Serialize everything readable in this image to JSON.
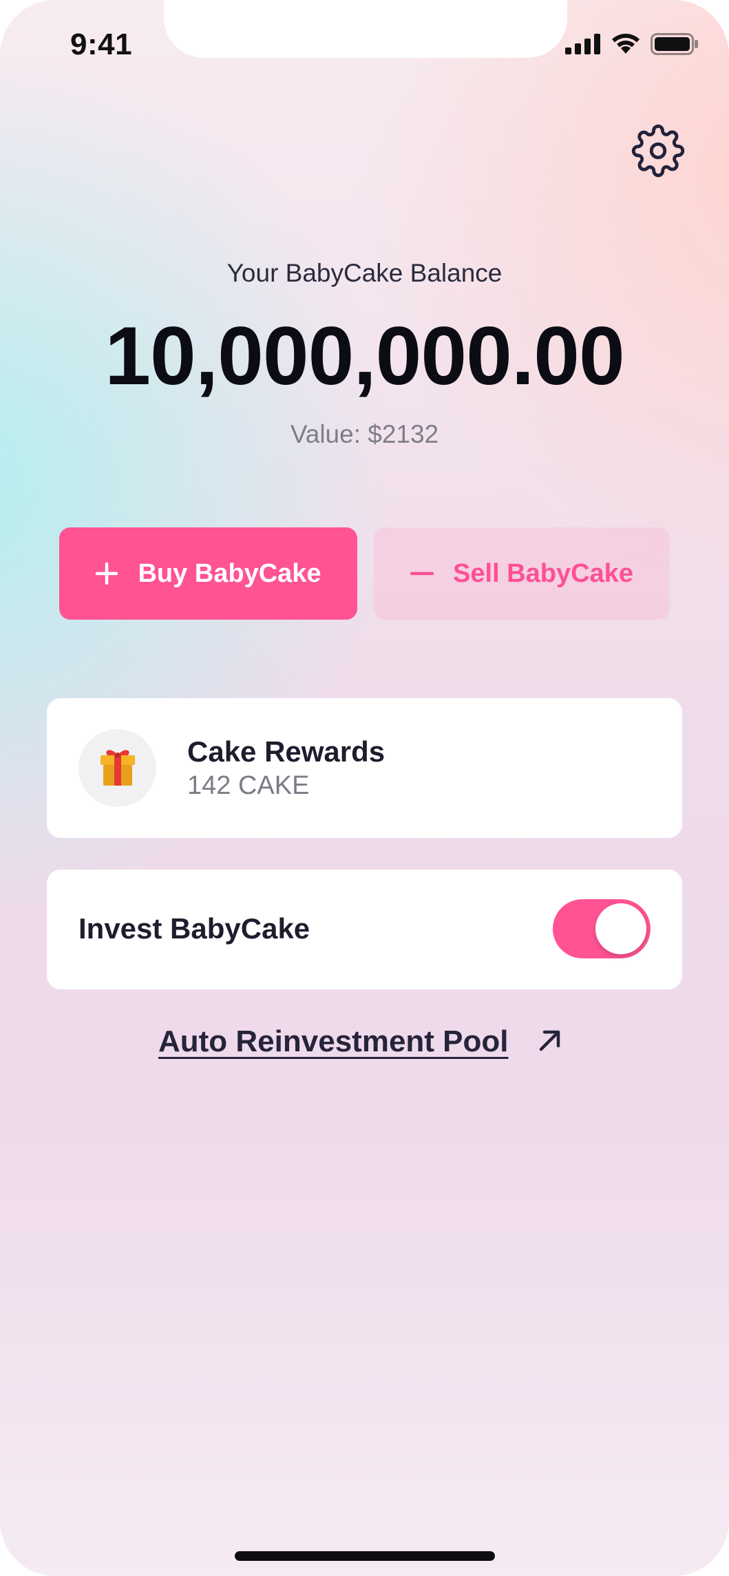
{
  "status_bar": {
    "time": "9:41"
  },
  "header": {
    "settings_icon": "gear-icon"
  },
  "balance": {
    "label": "Your BabyCake Balance",
    "amount": "10,000,000.00",
    "value": "Value: $2132"
  },
  "actions": {
    "buy_label": "Buy BabyCake",
    "buy_icon": "plus-icon",
    "sell_label": "Sell BabyCake",
    "sell_icon": "minus-icon"
  },
  "rewards": {
    "icon": "gift-icon",
    "title": "Cake Rewards",
    "amount": "142 CAKE"
  },
  "invest": {
    "label": "Invest BabyCake",
    "enabled": true
  },
  "pool_link": {
    "label": "Auto Reinvestment Pool",
    "icon": "arrow-up-right-icon"
  },
  "colors": {
    "accent": "#ff5394",
    "text_dark": "#1d1d2e",
    "text_muted": "#7c7a84"
  }
}
